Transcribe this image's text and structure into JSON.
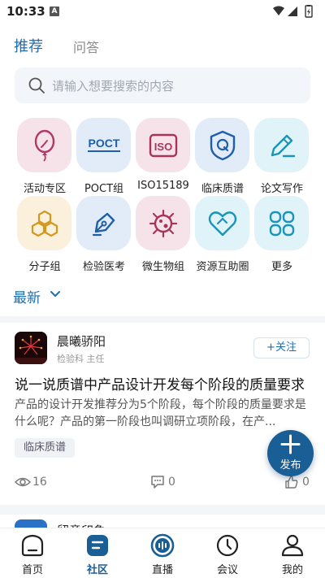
{
  "status_bar": {
    "time": "10:33",
    "notification_badge": "A"
  },
  "tabs": {
    "recommend": "推荐",
    "qa": "问答"
  },
  "search": {
    "placeholder": "请输入想要搜索的内容"
  },
  "categories": [
    {
      "label": "活动专区",
      "icon": "balloon-icon",
      "bg": "#f6e3ea",
      "color": "#b03a66"
    },
    {
      "label": "POCT组",
      "icon": "poct-icon",
      "bg": "#e1ecf8",
      "color": "#1f5ea8"
    },
    {
      "label": "ISO15189",
      "icon": "iso-icon",
      "bg": "#f6e3ea",
      "color": "#a8345c"
    },
    {
      "label": "临床质谱",
      "icon": "shield-q-icon",
      "bg": "#e1ecf8",
      "color": "#1f5ea8"
    },
    {
      "label": "论文写作",
      "icon": "pencil-icon",
      "bg": "#dff3f8",
      "color": "#1a95b8"
    },
    {
      "label": "分子组",
      "icon": "hexagon-icon",
      "bg": "#fbf0dc",
      "color": "#d19a1e"
    },
    {
      "label": "检验医考",
      "icon": "pen-nib-icon",
      "bg": "#e1ecf8",
      "color": "#1f5ea8"
    },
    {
      "label": "微生物组",
      "icon": "microbe-icon",
      "bg": "#f6e3ea",
      "color": "#a8345c"
    },
    {
      "label": "资源互助圈",
      "icon": "heart-link-icon",
      "bg": "#dff3f8",
      "color": "#1a95b8"
    },
    {
      "label": "更多",
      "icon": "more-icon",
      "bg": "#dff3f8",
      "color": "#1a95b8"
    }
  ],
  "feed": {
    "section_label": "最新",
    "post": {
      "author": "晨曦骄阳",
      "author_meta": "检验科 主任",
      "follow_label": "+关注",
      "title": "说一说质谱中产品设计开发每个阶段的质量要求",
      "excerpt": "产品的设计开发推荐分为5个阶段，每个阶段的质量要求是什么呢？产品的第一阶段也叫调研立项阶段，在产...",
      "tag": "临床质谱",
      "views": "16",
      "comments": "0",
      "likes": "0"
    },
    "next_post_author": "留意印象"
  },
  "publish": {
    "label": "发布"
  },
  "bottom_nav": [
    {
      "label": "首页",
      "icon": "home-icon"
    },
    {
      "label": "社区",
      "icon": "community-icon",
      "active": true
    },
    {
      "label": "直播",
      "icon": "live-icon"
    },
    {
      "label": "会议",
      "icon": "clock-icon"
    },
    {
      "label": "我的",
      "icon": "profile-icon"
    }
  ],
  "colors": {
    "accent": "#1f6fb0",
    "primary_dark": "#1a5e96"
  }
}
